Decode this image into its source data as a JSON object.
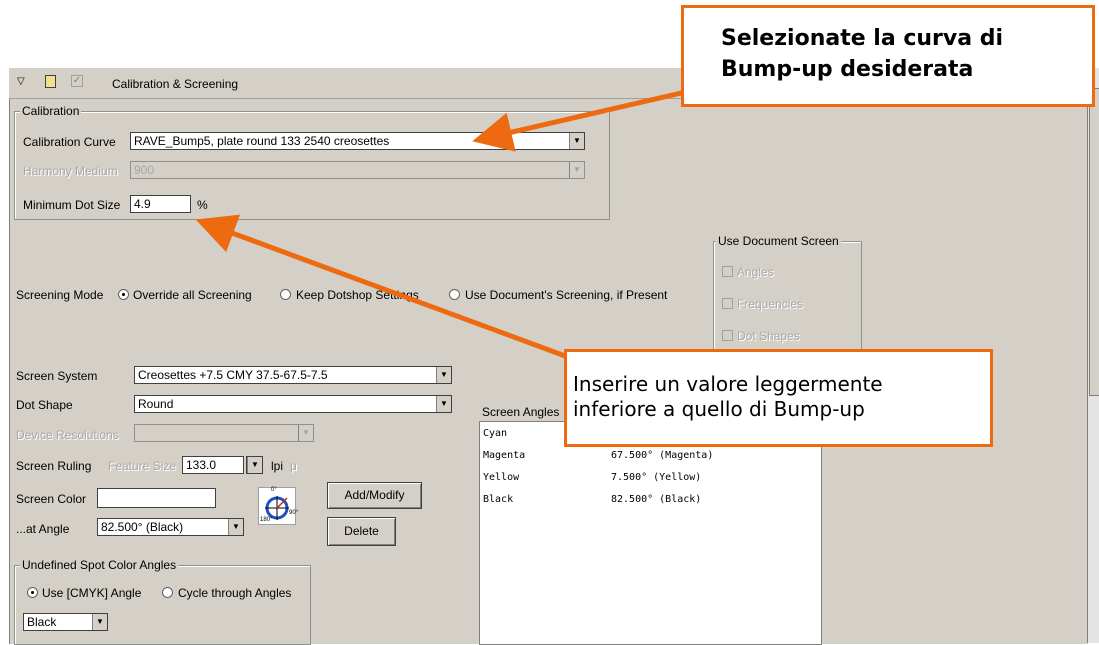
{
  "section": {
    "title": "Calibration & Screening"
  },
  "calibration": {
    "legend": "Calibration",
    "curve_label": "Calibration Curve",
    "curve_value": "RAVE_Bump5, plate round 133 2540 creosettes",
    "harmony_label": "Harmony Medium",
    "harmony_value": "900",
    "min_dot_label": "Minimum Dot Size",
    "min_dot_value": "4.9",
    "min_dot_unit": "%"
  },
  "screening_mode": {
    "label": "Screening Mode",
    "options": [
      "Override all Screening",
      "Keep Dotshop Settings",
      "Use Document's Screening, if Present"
    ],
    "selected": "Override all Screening"
  },
  "use_document_screen": {
    "legend": "Use Document Screen",
    "items": [
      "Angles",
      "Frequencies",
      "Dot Shapes"
    ]
  },
  "screen_system": {
    "label": "Screen System",
    "value": "Creosettes +7.5 CMY 37.5-67.5-7.5"
  },
  "dot_shape": {
    "label": "Dot Shape",
    "value": "Round"
  },
  "device_resolutions": {
    "label": "Device Resolutions",
    "value": ""
  },
  "screen_ruling": {
    "label": "Screen Ruling",
    "feature_size": "Feature Size",
    "value": "133.0",
    "unit": "lpi",
    "unit2": "μ"
  },
  "screen_color": {
    "label": "Screen Color",
    "value": ""
  },
  "at_angle": {
    "label": "...at Angle",
    "value": "82.500° (Black)"
  },
  "buttons": {
    "add_modify": "Add/Modify",
    "delete": "Delete"
  },
  "compass": {
    "label_0": "0°",
    "label_90": "90°",
    "label_180": "180°"
  },
  "undefined_spot": {
    "legend": "Undefined Spot Color Angles",
    "options": [
      "Use [CMYK] Angle",
      "Cycle through Angles"
    ],
    "selected": "Use [CMYK] Angle",
    "value": "Black"
  },
  "screen_angles": {
    "label": "Screen Angles",
    "rows": [
      {
        "name": "Cyan",
        "value": ""
      },
      {
        "name": "Magenta",
        "value": "67.500° (Magenta)"
      },
      {
        "name": "Yellow",
        "value": "7.500° (Yellow)"
      },
      {
        "name": "Black",
        "value": "82.500° (Black)"
      }
    ]
  },
  "callouts": {
    "top": {
      "line1": "Selezionate la curva di",
      "line2": "Bump-up desiderata"
    },
    "mid": {
      "line1": "Inserire un valore leggermente",
      "line2": "inferiore a quello di Bump-up"
    }
  },
  "colors": {
    "accent": "#ee6a10",
    "panel": "#d4d0c8"
  }
}
